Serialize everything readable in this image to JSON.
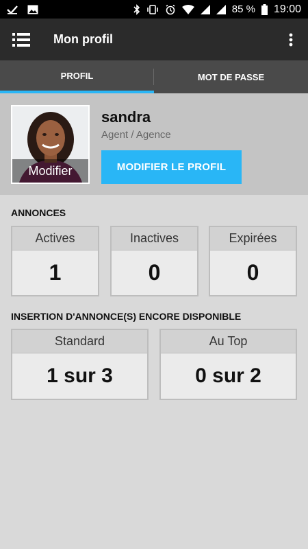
{
  "status_bar": {
    "battery_percent": "85 %",
    "time": "19:00"
  },
  "app_bar": {
    "title": "Mon profil"
  },
  "tabs": [
    {
      "label": "PROFIL",
      "active": true
    },
    {
      "label": "MOT DE PASSE",
      "active": false
    }
  ],
  "profile": {
    "name": "sandra",
    "role": "Agent / Agence",
    "avatar_label": "Modifier",
    "edit_button": "MODIFIER LE PROFIL"
  },
  "annonces": {
    "title": "ANNONCES",
    "cards": [
      {
        "label": "Actives",
        "value": "1"
      },
      {
        "label": "Inactives",
        "value": "0"
      },
      {
        "label": "Expirées",
        "value": "0"
      }
    ]
  },
  "insertion": {
    "title": "INSERTION  D'ANNONCE(S) ENCORE DISPONIBLE",
    "cards": [
      {
        "label": "Standard",
        "value": "1 sur 3"
      },
      {
        "label": "Au Top",
        "value": "0 sur 2"
      }
    ]
  },
  "colors": {
    "accent": "#29b6f6",
    "app_bar": "#2b2b2b",
    "tabs_bg": "#4a4a4a",
    "page_bg": "#d9d9d9"
  }
}
